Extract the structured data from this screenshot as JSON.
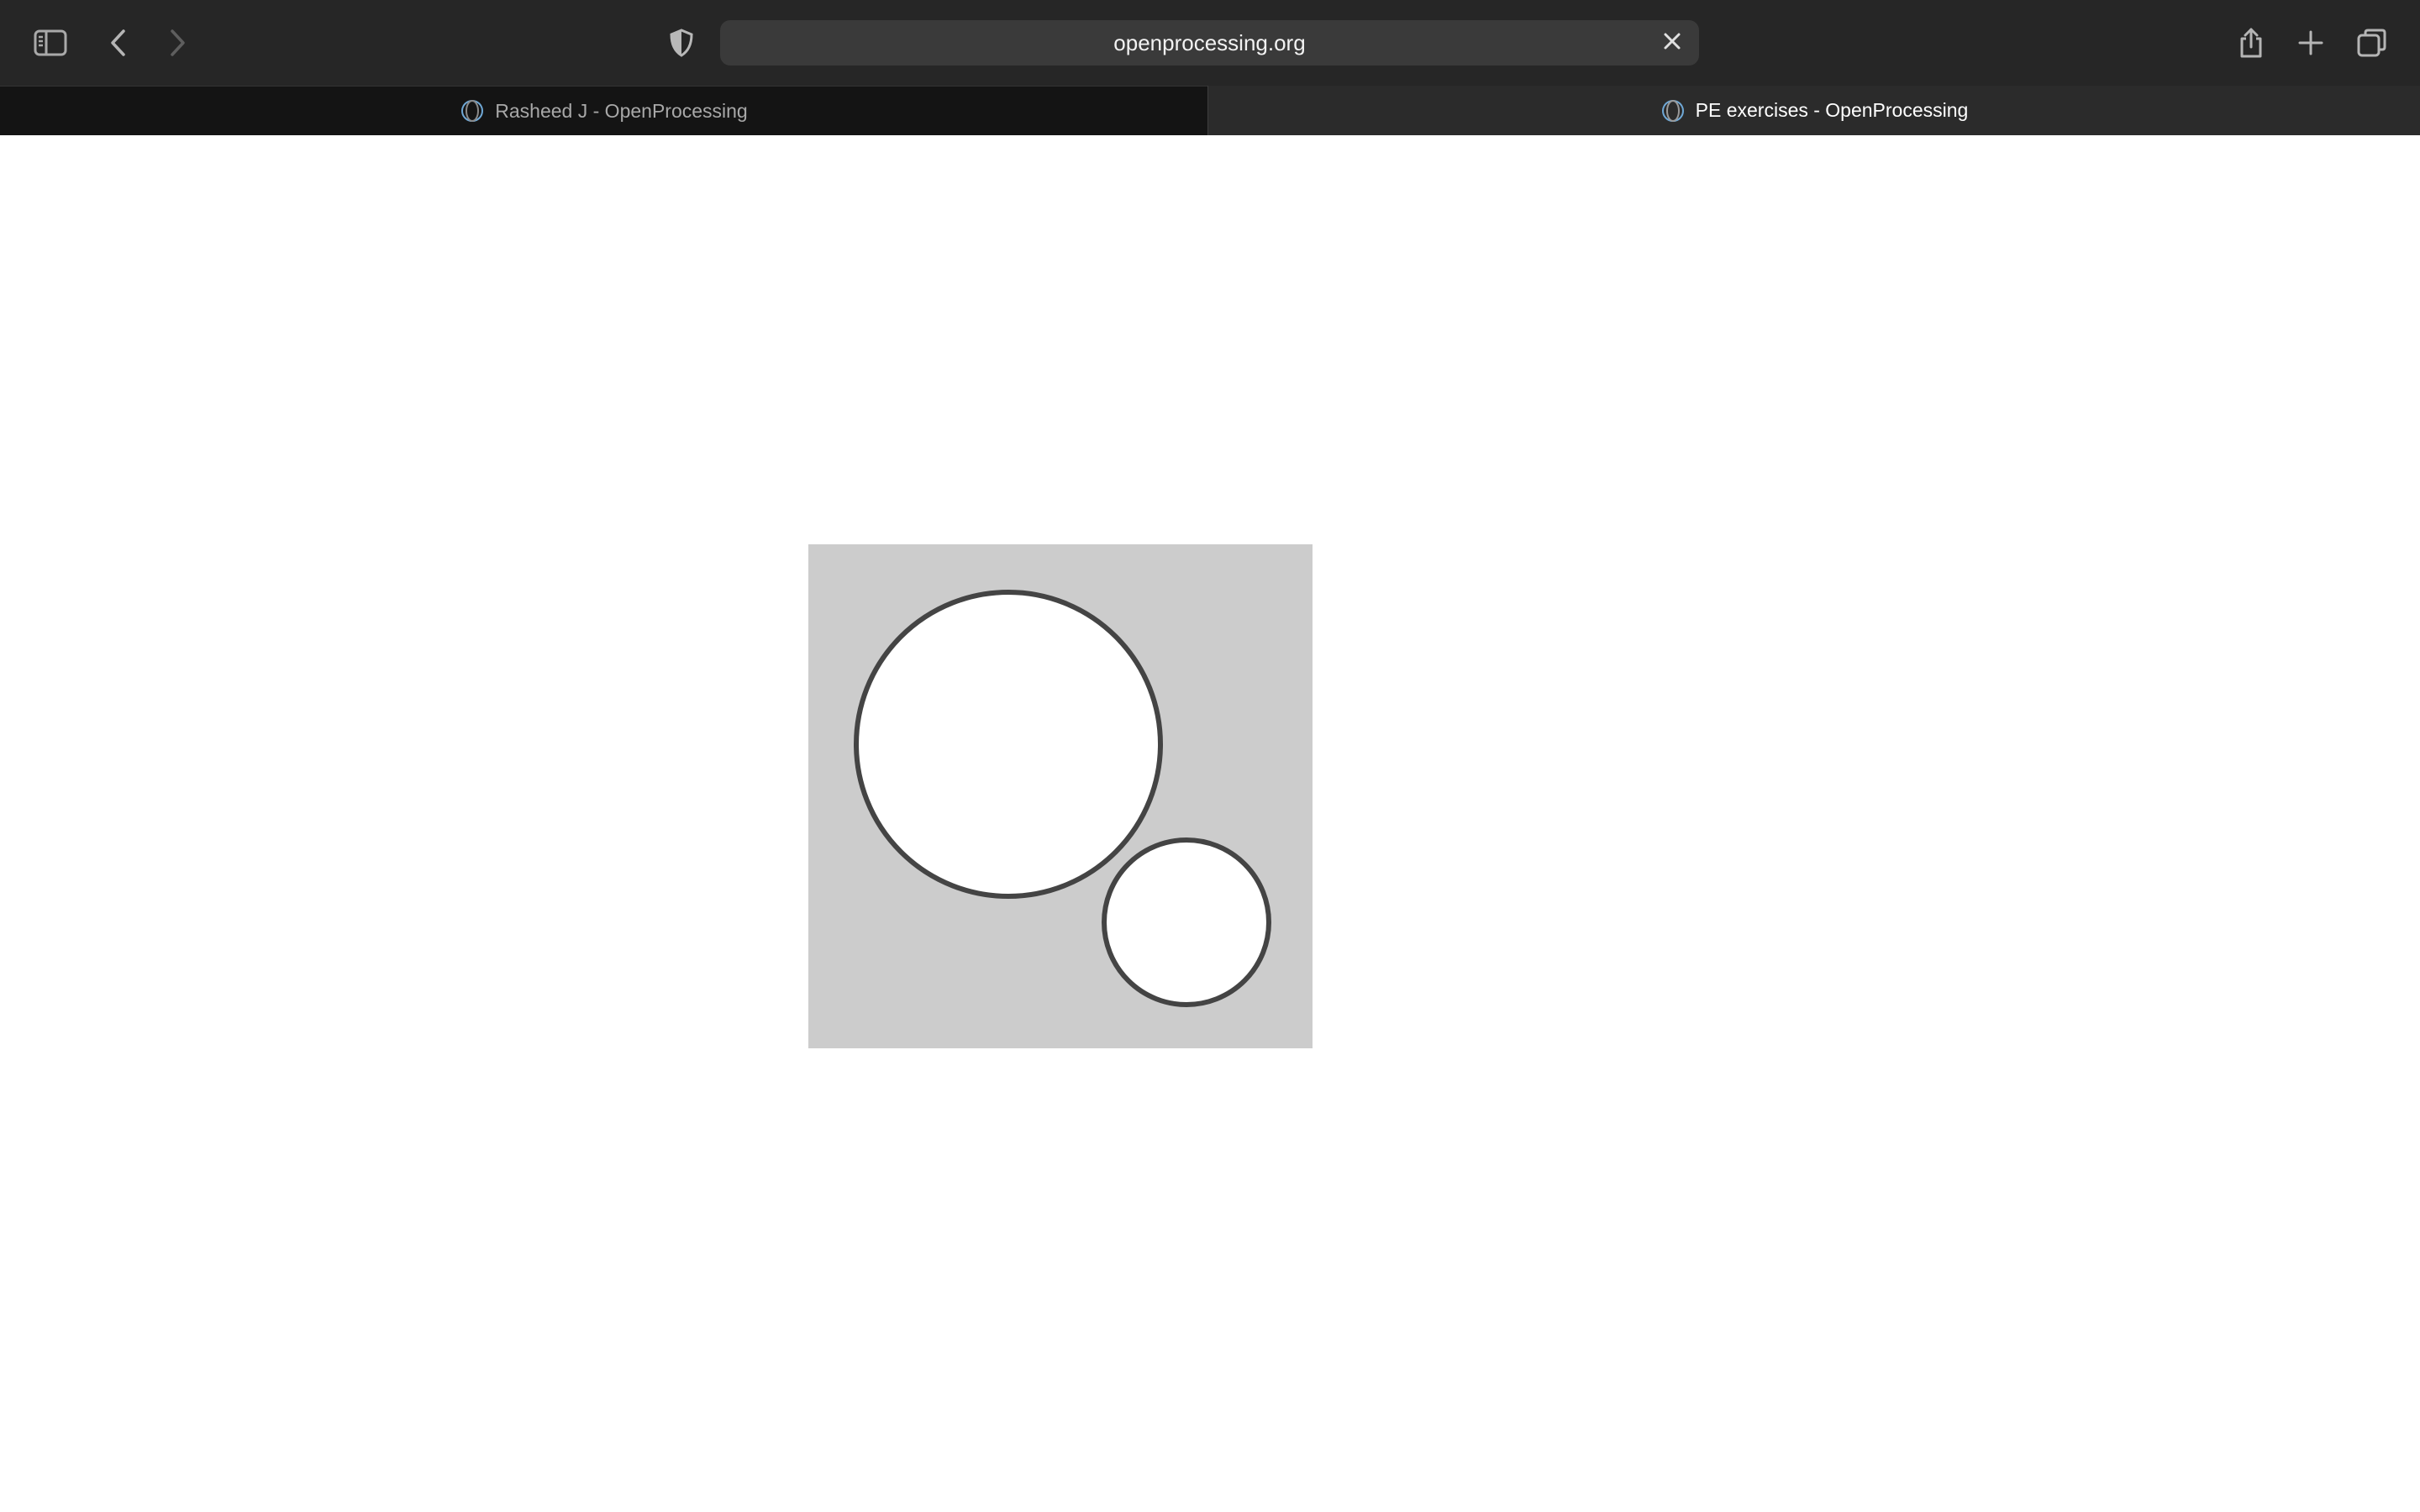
{
  "browser": {
    "address": "openprocessing.org",
    "tabs": [
      {
        "label": "Rasheed J - OpenProcessing",
        "active": false
      },
      {
        "label": "PE exercises - OpenProcessing",
        "active": true
      }
    ]
  },
  "icons": {
    "sidebar": "sidebar-icon",
    "back": "chevron-left-icon",
    "forward": "chevron-right-icon",
    "privacy": "shield-icon",
    "clear": "close-icon",
    "share": "share-icon",
    "new_tab": "plus-icon",
    "tab_overview": "tabs-icon",
    "favicon": "openprocessing-icon"
  },
  "colors": {
    "toolbar": "#262626",
    "inactive_tab": "#141414",
    "active_tab": "#2b2b2b",
    "canvas_background": "#cccccc",
    "circle_fill": "#ffffff",
    "circle_stroke": "#444444"
  },
  "sketch": {
    "description_shapes": [
      "large-circle",
      "small-circle"
    ]
  }
}
